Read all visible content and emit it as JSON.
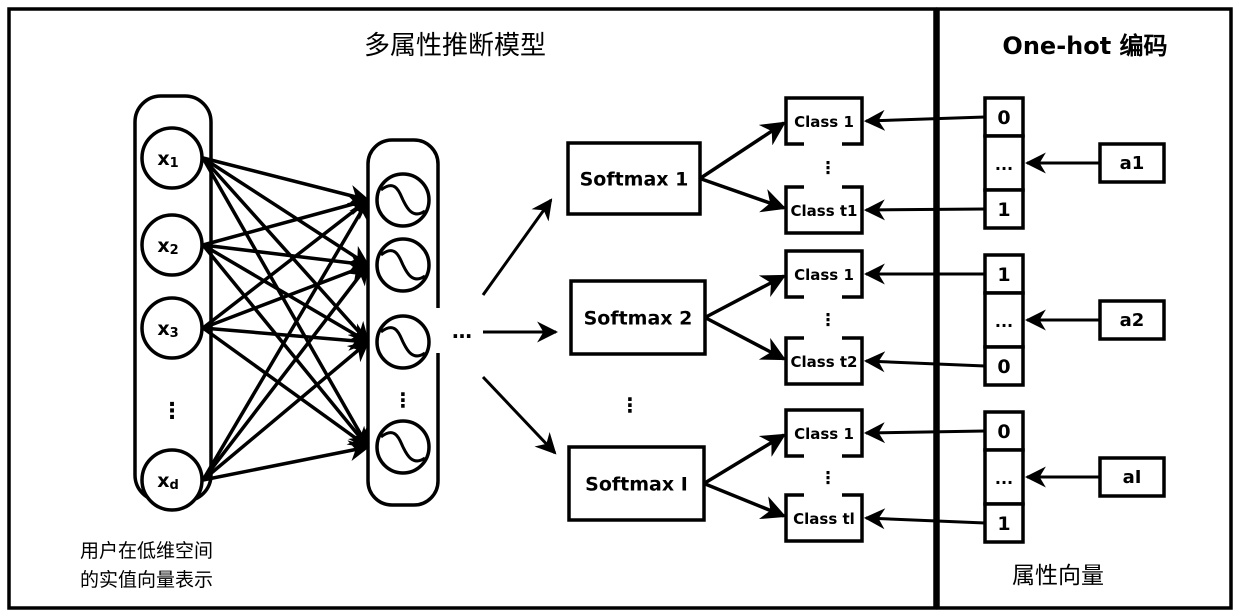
{
  "left_panel": {
    "title": "多属性推断模型",
    "input_layer": {
      "nodes": [
        {
          "label": "x",
          "sub": "1"
        },
        {
          "label": "x",
          "sub": "2"
        },
        {
          "label": "x",
          "sub": "3"
        },
        {
          "label": "x",
          "sub": "d"
        }
      ],
      "ellipsis": "⋮",
      "caption_line1": "用户在低维空间",
      "caption_line2": "的实值向量表示"
    },
    "hidden_layer": {
      "unit_count_shown": 4,
      "unit_icon": "sigmoid-wave-icon",
      "ellipsis": "⋮"
    },
    "between_ellipsis": "…",
    "softmax_ellipsis": "⋮",
    "softmax_groups": [
      {
        "label": "Softmax 1",
        "classes": [
          "Class 1",
          "Class t1"
        ]
      },
      {
        "label": "Softmax 2",
        "classes": [
          "Class 1",
          "Class t2"
        ]
      },
      {
        "label": "Softmax I",
        "classes": [
          "Class 1",
          "Class tl"
        ]
      }
    ],
    "class_ellipsis": "⋮"
  },
  "right_panel": {
    "title": "One-hot 编码",
    "caption": "属性向量",
    "vectors": [
      {
        "attribute": "a1",
        "cells": [
          "0",
          "...",
          "1"
        ]
      },
      {
        "attribute": "a2",
        "cells": [
          "1",
          "...",
          "0"
        ]
      },
      {
        "attribute": "aI",
        "cells": [
          "0",
          "...",
          "1"
        ]
      }
    ]
  }
}
